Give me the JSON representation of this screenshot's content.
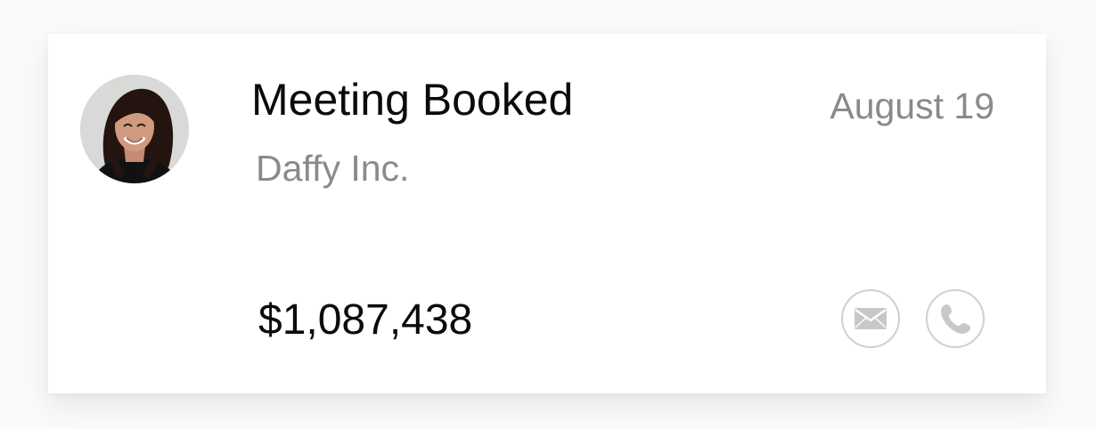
{
  "notification": {
    "title": "Meeting Booked",
    "date": "August 19",
    "company": "Daffy Inc.",
    "amount": "$1,087,438"
  },
  "actions": {
    "email_icon": "email-icon",
    "phone_icon": "phone-icon"
  },
  "colors": {
    "title": "#0b0b0b",
    "muted": "#8a8a8a",
    "icon_border": "#d0d0d0",
    "icon_fill": "#c8c8c8"
  }
}
